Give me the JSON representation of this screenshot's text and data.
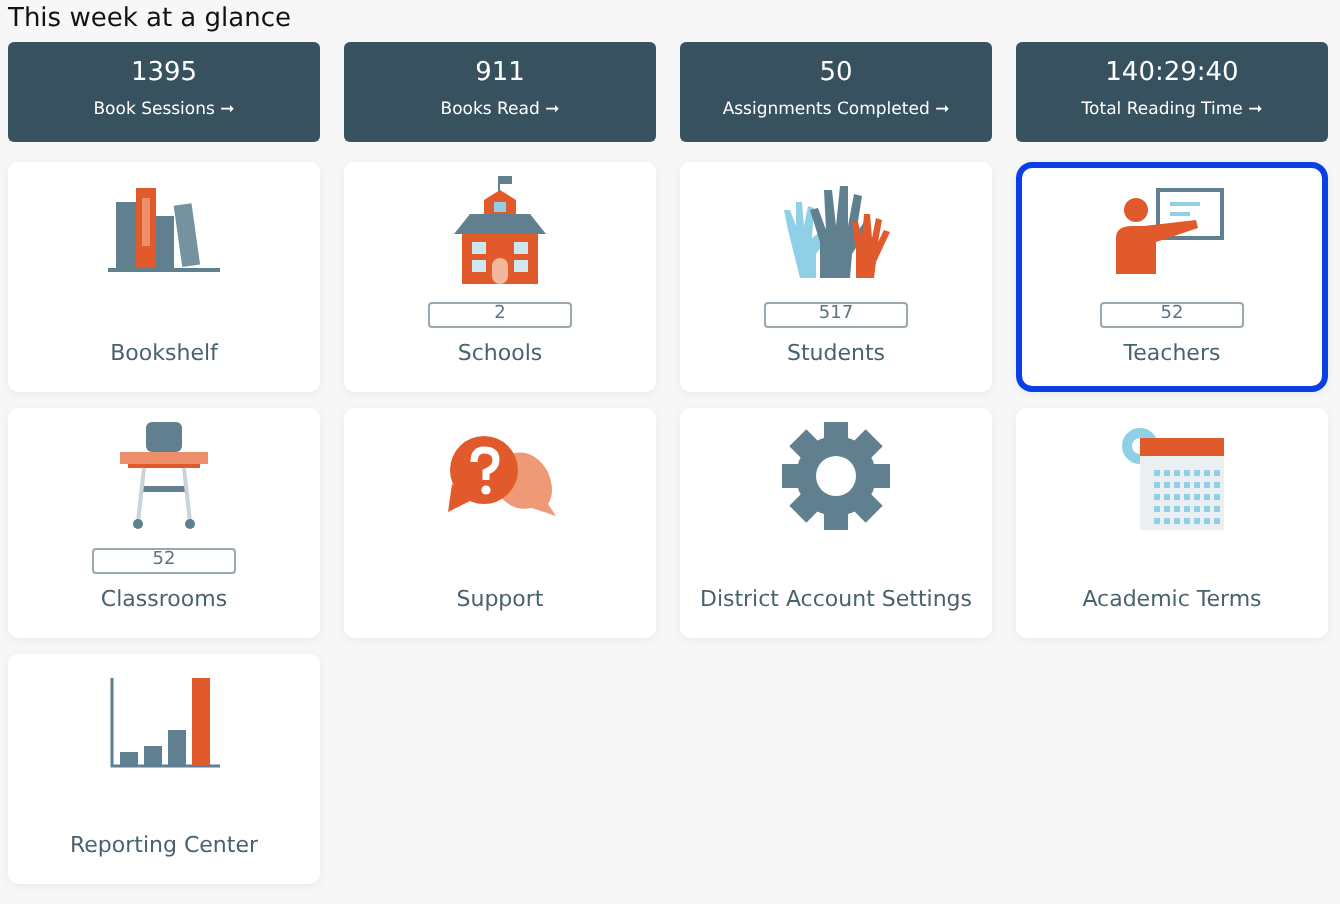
{
  "heading": "This week at a glance",
  "stats": [
    {
      "value": "1395",
      "label": "Book Sessions",
      "arrow": "➞"
    },
    {
      "value": "911",
      "label": "Books Read",
      "arrow": "➞"
    },
    {
      "value": "50",
      "label": "Assignments Completed",
      "arrow": "➞"
    },
    {
      "value": "140:29:40",
      "label": "Total Reading Time",
      "arrow": "➞"
    }
  ],
  "tiles": [
    {
      "label": "Bookshelf",
      "selected": false
    },
    {
      "label": "Schools",
      "count": "2",
      "selected": false
    },
    {
      "label": "Students",
      "count": "517",
      "selected": false
    },
    {
      "label": "Teachers",
      "count": "52",
      "selected": true
    },
    {
      "label": "Classrooms",
      "count": "52",
      "selected": false
    },
    {
      "label": "Support",
      "selected": false
    },
    {
      "label": "District Account Settings",
      "selected": false
    },
    {
      "label": "Academic Terms",
      "selected": false
    },
    {
      "label": "Reporting Center",
      "selected": false
    }
  ]
}
